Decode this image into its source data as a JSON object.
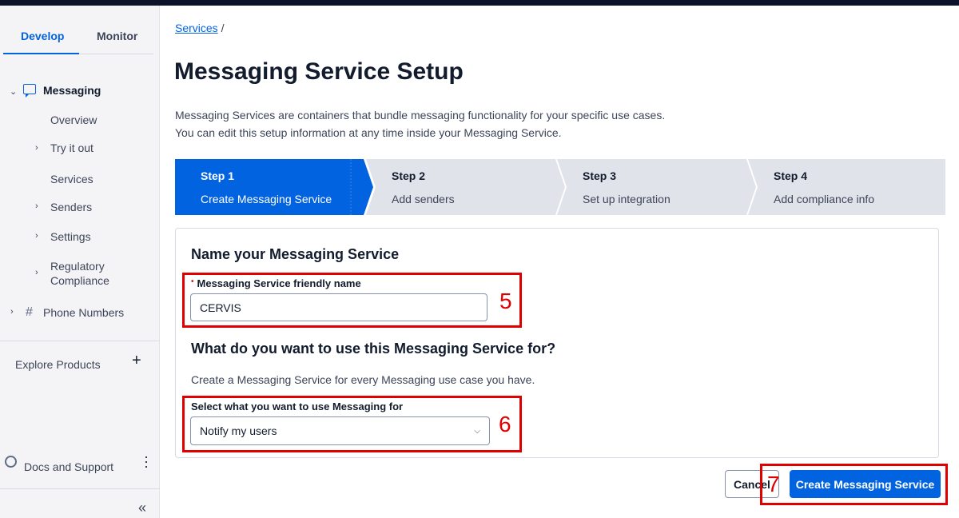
{
  "sidebar": {
    "tabs": {
      "develop": "Develop",
      "monitor": "Monitor"
    },
    "nav": {
      "messaging": "Messaging",
      "overview": "Overview",
      "try_it_out": "Try it out",
      "services": "Services",
      "senders": "Senders",
      "settings": "Settings",
      "regulatory_1": "Regulatory",
      "regulatory_2": "Compliance",
      "phone_numbers": "Phone Numbers"
    },
    "explore_products": "Explore Products",
    "docs_and_support": "Docs and Support"
  },
  "breadcrumb": {
    "link": "Services",
    "separator": "/"
  },
  "page_title": "Messaging Service Setup",
  "description": {
    "line1": "Messaging Services are containers that bundle messaging functionality for your specific use cases.",
    "line2": "You can edit this setup information at any time inside your Messaging Service."
  },
  "steps": [
    {
      "number": "Step 1",
      "label": "Create Messaging Service",
      "active": true
    },
    {
      "number": "Step 2",
      "label": "Add senders",
      "active": false
    },
    {
      "number": "Step 3",
      "label": "Set up integration",
      "active": false
    },
    {
      "number": "Step 4",
      "label": "Add compliance info",
      "active": false
    }
  ],
  "form": {
    "name_heading": "Name your Messaging Service",
    "friendly_name_label": "Messaging Service friendly name",
    "friendly_name_value": "CERVIS",
    "use_heading": "What do you want to use this Messaging Service for?",
    "use_description": "Create a Messaging Service for every Messaging use case you have.",
    "use_select_label": "Select what you want to use Messaging for",
    "use_select_value": "Notify my users"
  },
  "buttons": {
    "cancel": "Cancel",
    "create": "Create Messaging Service"
  },
  "annotations": {
    "five": "5",
    "six": "6",
    "seven": "7"
  },
  "colors": {
    "brand_blue": "#0263e0",
    "annotation_red": "#e00000",
    "step_inactive": "#e1e3ea"
  }
}
